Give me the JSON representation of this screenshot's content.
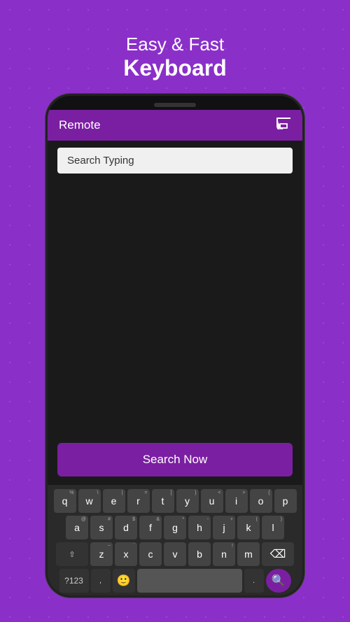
{
  "header": {
    "line1": "Easy & Fast",
    "line2": "Keyboard"
  },
  "appbar": {
    "title": "Remote",
    "cast_icon": "⬛"
  },
  "search": {
    "placeholder": "Search Typing",
    "value": "Search Typing"
  },
  "button": {
    "search_now": "Search Now"
  },
  "keyboard": {
    "row1": [
      {
        "label": "q",
        "sym": "%"
      },
      {
        "label": "w",
        "sym": "\\"
      },
      {
        "label": "e",
        "sym": "|"
      },
      {
        "label": "r",
        "sym": "="
      },
      {
        "label": "t",
        "sym": "["
      },
      {
        "label": "y",
        "sym": "}"
      },
      {
        "label": "u",
        "sym": "<"
      },
      {
        "label": "i",
        "sym": ">"
      },
      {
        "label": "o",
        "sym": "{"
      },
      {
        "label": "p",
        "sym": ""
      }
    ],
    "row2": [
      {
        "label": "a",
        "sym": "@"
      },
      {
        "label": "s",
        "sym": "#"
      },
      {
        "label": "d",
        "sym": "$"
      },
      {
        "label": "f",
        "sym": "&"
      },
      {
        "label": "g",
        "sym": "*"
      },
      {
        "label": "h",
        "sym": "-"
      },
      {
        "label": "j",
        "sym": "+"
      },
      {
        "label": "k",
        "sym": "("
      },
      {
        "label": "l",
        "sym": ")"
      }
    ],
    "row3": [
      {
        "label": "z",
        "sym": "~"
      },
      {
        "label": "x",
        "sym": "`"
      },
      {
        "label": "c",
        "sym": ""
      },
      {
        "label": "v",
        "sym": ""
      },
      {
        "label": "b",
        "sym": ""
      },
      {
        "label": "n",
        "sym": "!"
      },
      {
        "label": "m",
        "sym": ""
      }
    ],
    "bottom": {
      "numbers": "?123",
      "comma": ",",
      "period": ".",
      "space": ""
    }
  }
}
